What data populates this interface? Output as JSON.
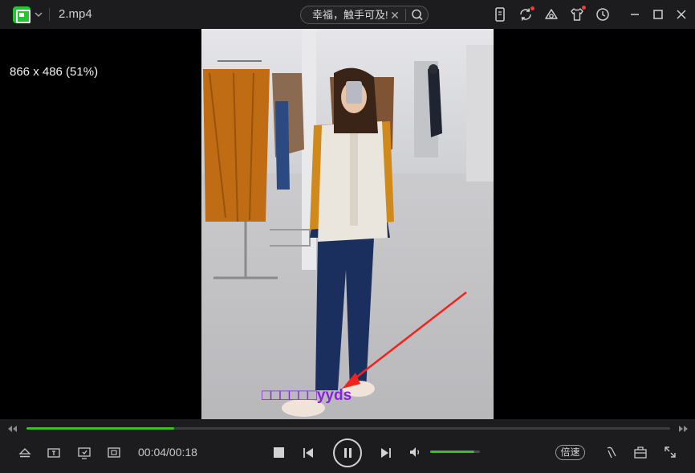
{
  "app": {
    "file_title": "2.mp4",
    "logo_icon": "iqiyi-logo-icon"
  },
  "search": {
    "text": "幸福，触手可及!",
    "clear_glyph": "✕"
  },
  "titlebar_icons": [
    "phone-cast-icon",
    "refresh-sync-icon",
    "skin-icon",
    "shirt-icon",
    "history-clock-icon",
    "minimize-icon",
    "maximize-icon",
    "close-icon"
  ],
  "video": {
    "resolution_info": "866 x 486 (51%)",
    "overlay_text": "□□□□□□yyds",
    "overlay_color": "#8a1fe0",
    "arrow_color": "#f2231f"
  },
  "playback": {
    "time_display": "00:04/00:18",
    "progress": 0.23,
    "volume": 0.88,
    "speed_label": "倍速"
  },
  "colors": {
    "accent": "#3fbb2c",
    "titlebar_bg": "#1c1c1e",
    "notify_dot": "#f43b3b"
  }
}
